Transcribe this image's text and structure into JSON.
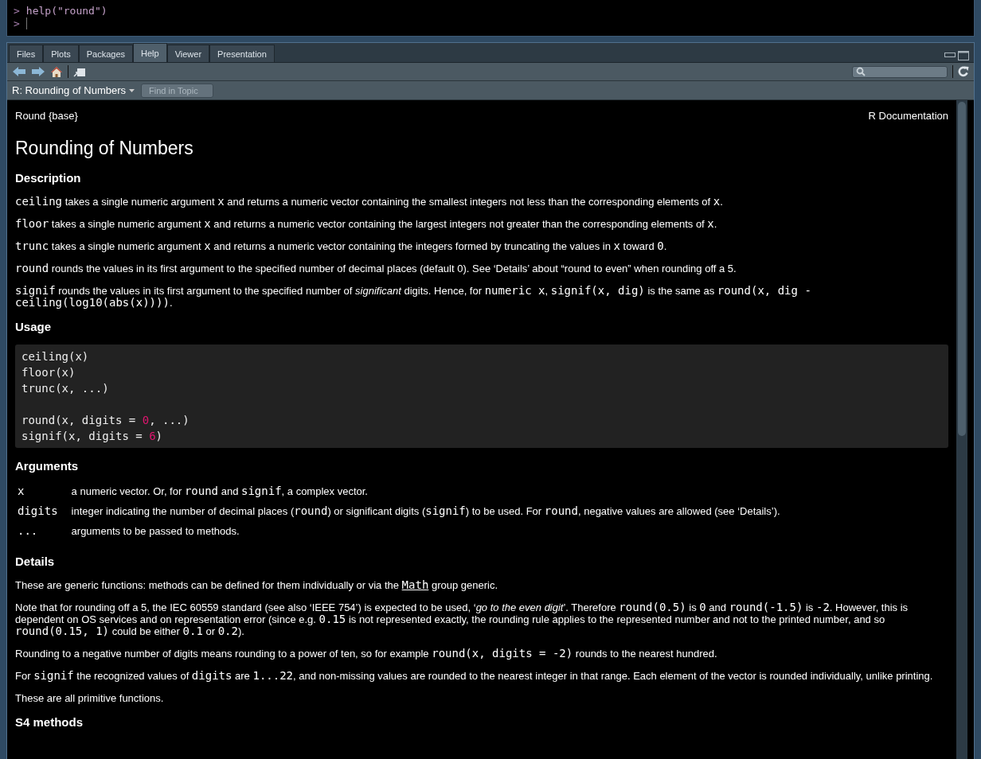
{
  "console": {
    "lines": [
      {
        "prompt": ">",
        "command": "help(\"round\")"
      },
      {
        "prompt": ">",
        "cursor": true
      }
    ]
  },
  "pane": {
    "tabs": [
      {
        "label": "Files",
        "selected": false
      },
      {
        "label": "Plots",
        "selected": false
      },
      {
        "label": "Packages",
        "selected": false
      },
      {
        "label": "Help",
        "selected": true
      },
      {
        "label": "Viewer",
        "selected": false
      },
      {
        "label": "Presentation",
        "selected": false
      }
    ],
    "topic": "R: Rounding of Numbers",
    "find_placeholder": "Find in Topic"
  },
  "document": {
    "package_label": "Round {base}",
    "source_label": "R Documentation",
    "title": "Rounding of Numbers",
    "sections": [
      {
        "kind": "paragraphs",
        "heading": "Description",
        "paragraphs": [
          [
            {
              "kind": "code",
              "text": "ceiling"
            },
            {
              "kind": "text",
              "text": " takes a single numeric argument "
            },
            {
              "kind": "code",
              "text": "x"
            },
            {
              "kind": "text",
              "text": " and returns a numeric vector containing the smallest integers not less than the corresponding elements of "
            },
            {
              "kind": "code",
              "text": "x"
            },
            {
              "kind": "text",
              "text": "."
            }
          ],
          [
            {
              "kind": "code",
              "text": "floor"
            },
            {
              "kind": "text",
              "text": " takes a single numeric argument "
            },
            {
              "kind": "code",
              "text": "x"
            },
            {
              "kind": "text",
              "text": " and returns a numeric vector containing the largest integers not greater than the corresponding elements of "
            },
            {
              "kind": "code",
              "text": "x"
            },
            {
              "kind": "text",
              "text": "."
            }
          ],
          [
            {
              "kind": "code",
              "text": "trunc"
            },
            {
              "kind": "text",
              "text": " takes a single numeric argument "
            },
            {
              "kind": "code",
              "text": "x"
            },
            {
              "kind": "text",
              "text": " and returns a numeric vector containing the integers formed by truncating the values in "
            },
            {
              "kind": "code",
              "text": "x"
            },
            {
              "kind": "text",
              "text": " toward "
            },
            {
              "kind": "code",
              "text": "0"
            },
            {
              "kind": "text",
              "text": "."
            }
          ],
          [
            {
              "kind": "code",
              "text": "round"
            },
            {
              "kind": "text",
              "text": " rounds the values in its first argument to the specified number of decimal places (default 0). See ‘Details’ about “round to even” when rounding off a 5."
            }
          ],
          [
            {
              "kind": "code",
              "text": "signif"
            },
            {
              "kind": "text",
              "text": " rounds the values in its first argument to the specified number of "
            },
            {
              "kind": "italic",
              "text": "significant"
            },
            {
              "kind": "text",
              "text": " digits. Hence, for "
            },
            {
              "kind": "code",
              "text": "numeric x"
            },
            {
              "kind": "text",
              "text": ", "
            },
            {
              "kind": "code",
              "text": "signif(x, dig)"
            },
            {
              "kind": "text",
              "text": " is the same as "
            },
            {
              "kind": "code",
              "text": "round(x, dig - ceiling(log10(abs(x))))"
            },
            {
              "kind": "text",
              "text": "."
            }
          ]
        ]
      },
      {
        "kind": "usage",
        "heading": "Usage",
        "blocks": [
          [
            [
              {
                "kind": "plain",
                "text": "ceiling(x)"
              }
            ],
            [
              {
                "kind": "plain",
                "text": "floor(x)"
              }
            ],
            [
              {
                "kind": "plain",
                "text": "trunc(x, ...)"
              }
            ]
          ],
          [
            [
              {
                "kind": "plain",
                "text": "round(x, digits = "
              },
              {
                "kind": "number",
                "text": "0"
              },
              {
                "kind": "plain",
                "text": ", ...)"
              }
            ],
            [
              {
                "kind": "plain",
                "text": "signif(x, digits = "
              },
              {
                "kind": "number",
                "text": "6"
              },
              {
                "kind": "plain",
                "text": ")"
              }
            ]
          ]
        ]
      },
      {
        "kind": "arguments",
        "heading": "Arguments",
        "arguments": [
          {
            "name": "x",
            "description": [
              {
                "kind": "text",
                "text": "a numeric vector. Or, for "
              },
              {
                "kind": "code",
                "text": "round"
              },
              {
                "kind": "text",
                "text": " and "
              },
              {
                "kind": "code",
                "text": "signif"
              },
              {
                "kind": "text",
                "text": ", a complex vector."
              }
            ]
          },
          {
            "name": "digits",
            "description": [
              {
                "kind": "text",
                "text": "integer indicating the number of decimal places ("
              },
              {
                "kind": "code",
                "text": "round"
              },
              {
                "kind": "text",
                "text": ") or significant digits ("
              },
              {
                "kind": "code",
                "text": "signif"
              },
              {
                "kind": "text",
                "text": ") to be used. For "
              },
              {
                "kind": "code",
                "text": "round"
              },
              {
                "kind": "text",
                "text": ", negative values are allowed (see ‘Details’)."
              }
            ]
          },
          {
            "name": "...",
            "description": [
              {
                "kind": "text",
                "text": "arguments to be passed to methods."
              }
            ]
          }
        ]
      },
      {
        "kind": "paragraphs",
        "heading": "Details",
        "paragraphs": [
          [
            {
              "kind": "text",
              "text": "These are generic functions: methods can be defined for them individually or via the "
            },
            {
              "kind": "link",
              "text": "Math"
            },
            {
              "kind": "text",
              "text": " group generic."
            }
          ],
          [
            {
              "kind": "text",
              "text": "Note that for rounding off a 5, the IEC 60559 standard (see also ‘IEEE 754’) is expected to be used, ‘"
            },
            {
              "kind": "italic",
              "text": "go to the even digit"
            },
            {
              "kind": "text",
              "text": "’. Therefore "
            },
            {
              "kind": "code",
              "text": "round(0.5)"
            },
            {
              "kind": "text",
              "text": " is "
            },
            {
              "kind": "code",
              "text": "0"
            },
            {
              "kind": "text",
              "text": " and "
            },
            {
              "kind": "code",
              "text": "round(-1.5)"
            },
            {
              "kind": "text",
              "text": " is "
            },
            {
              "kind": "code",
              "text": "-2"
            },
            {
              "kind": "text",
              "text": ". However, this is dependent on OS services and on representation error (since e.g. "
            },
            {
              "kind": "code",
              "text": "0.15"
            },
            {
              "kind": "text",
              "text": " is not represented exactly, the rounding rule applies to the represented number and not to the printed number, and so "
            },
            {
              "kind": "code",
              "text": "round(0.15, 1)"
            },
            {
              "kind": "text",
              "text": " could be either "
            },
            {
              "kind": "code",
              "text": "0.1"
            },
            {
              "kind": "text",
              "text": " or "
            },
            {
              "kind": "code",
              "text": "0.2"
            },
            {
              "kind": "text",
              "text": ")."
            }
          ],
          [
            {
              "kind": "text",
              "text": "Rounding to a negative number of digits means rounding to a power of ten, so for example "
            },
            {
              "kind": "code",
              "text": "round(x, digits = -2)"
            },
            {
              "kind": "text",
              "text": " rounds to the nearest hundred."
            }
          ],
          [
            {
              "kind": "text",
              "text": "For "
            },
            {
              "kind": "code",
              "text": "signif"
            },
            {
              "kind": "text",
              "text": " the recognized values of "
            },
            {
              "kind": "code",
              "text": "digits"
            },
            {
              "kind": "text",
              "text": " are "
            },
            {
              "kind": "code",
              "text": "1...22"
            },
            {
              "kind": "text",
              "text": ", and non-missing values are rounded to the nearest integer in that range. Each element of the vector is rounded individually, unlike printing."
            }
          ],
          [
            {
              "kind": "text",
              "text": "These are all primitive functions."
            }
          ]
        ]
      },
      {
        "kind": "paragraphs",
        "heading": "S4 methods"
      }
    ]
  }
}
